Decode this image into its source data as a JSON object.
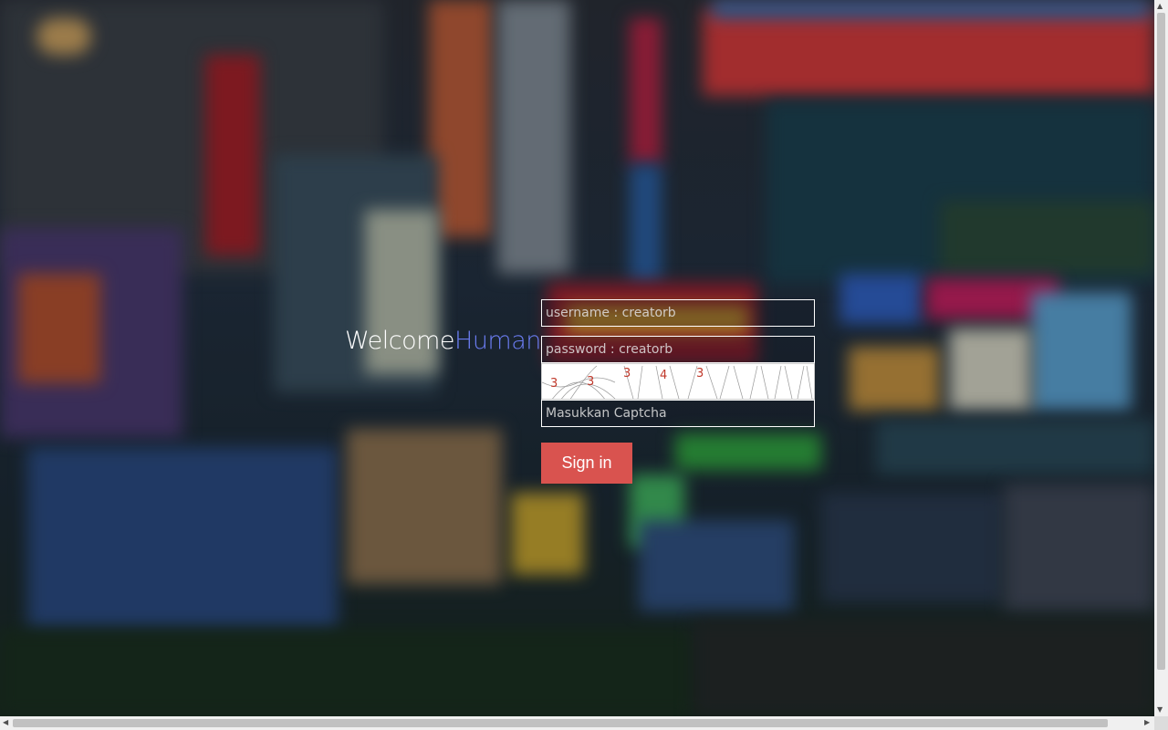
{
  "welcome": {
    "first": "Welcome",
    "second": "Human",
    "accent_color": "#6a7cf0"
  },
  "login": {
    "username_placeholder": "username : creatorb",
    "password_placeholder": "password : creatorb",
    "captcha_placeholder": "Masukkan Captcha",
    "captcha_digits": [
      "3",
      "3",
      "3",
      "4",
      "3"
    ],
    "signin_label": "Sign in",
    "signin_color": "#d9534f"
  },
  "scrollbars": {
    "up": "▲",
    "down": "▼",
    "left": "◀",
    "right": "▶"
  }
}
